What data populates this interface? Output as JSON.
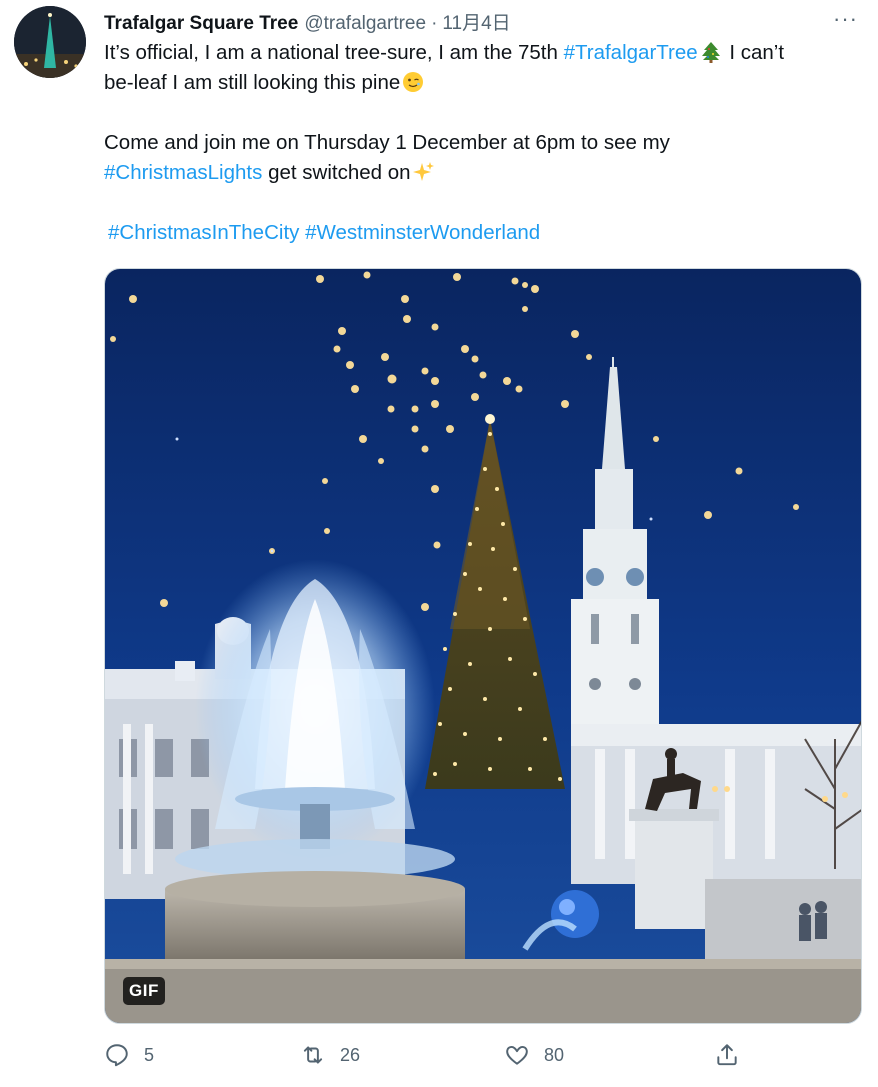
{
  "tweet": {
    "display_name": "Trafalgar Square Tree",
    "handle": "@trafalgartree",
    "separator": "·",
    "date": "11月4日",
    "more_label": "···",
    "line1_a": "It’s official, I am a national tree-sure, I am the 75th ",
    "line1_tag": "#TrafalgarTree",
    "line1_b": " I can’t",
    "line2_a": "be-leaf I am still looking this pine",
    "line3": "Come and join me on Thursday 1 December at 6pm to see my",
    "line4_tag": "#ChristmasLights",
    "line4_b": " get switched on",
    "tag_a": "#ChristmasInTheCity",
    "tag_b": "#WestminsterWonderland",
    "emoji_1": "christmas-tree-emoji",
    "emoji_2": "winking-face-emoji",
    "emoji_3": "sparkles-emoji"
  },
  "media": {
    "badge": "GIF",
    "description_icon": "trafalgar-square-christmas-tree-image"
  },
  "actions": {
    "reply_count": "5",
    "retweet_count": "26",
    "like_count": "80",
    "reply_icon": "reply-icon",
    "retweet_icon": "retweet-icon",
    "like_icon": "heart-icon",
    "share_icon": "share-icon"
  },
  "colors": {
    "link": "#1d9bf0",
    "text": "#0f1419",
    "muted": "#536471",
    "sky": "#0b2d6e"
  }
}
